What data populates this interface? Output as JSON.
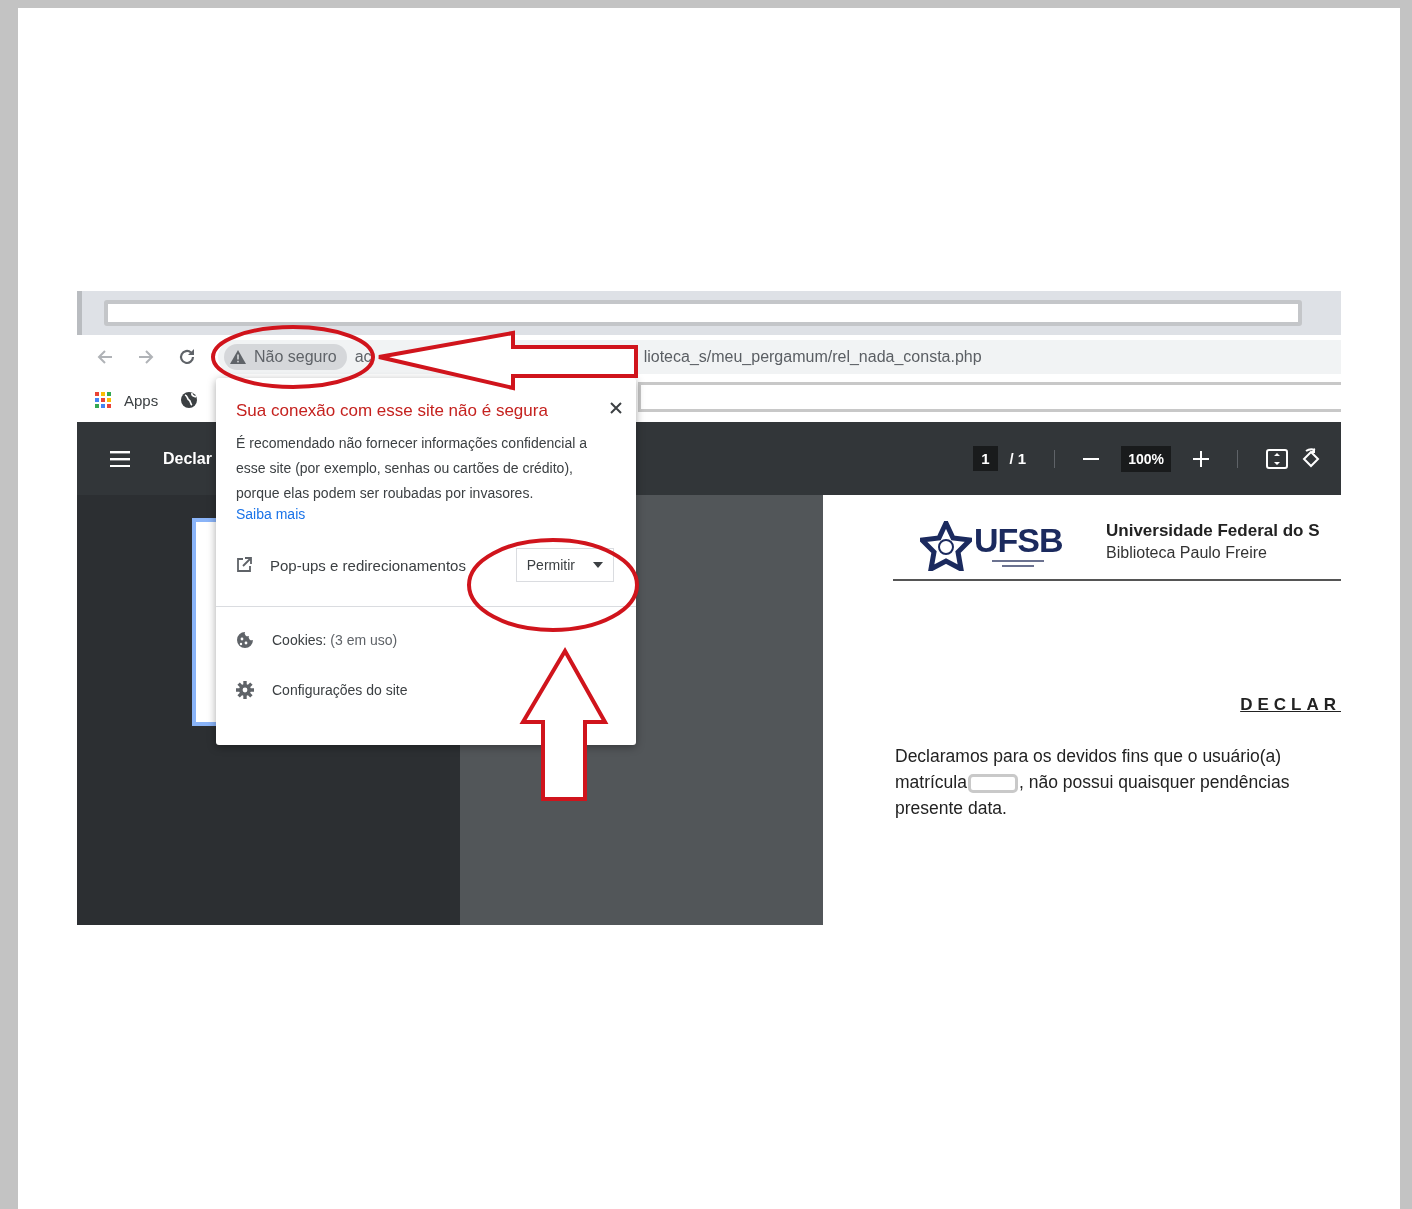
{
  "browser": {
    "omnibox": {
      "security_chip": "Não seguro",
      "url_start": "ac",
      "url_end": "lioteca_s/meu_pergamum/rel_nada_consta.php"
    },
    "bookmarks": [
      {
        "kind": "apps",
        "label": "Apps"
      },
      {
        "kind": "site"
      }
    ]
  },
  "pdf_toolbar": {
    "title": "Declar",
    "page": "1",
    "page_total": "/ 1",
    "zoom": "100%"
  },
  "site_popup": {
    "title": "Sua conexão com esse site não é segura",
    "body": "É recomendado não fornecer informações confidencial a esse site (por exemplo, senhas ou cartões de crédito), porque elas podem ser roubadas por invasores.",
    "link": "Saiba mais",
    "permissions": [
      {
        "label": "Pop-ups e redirecionamentos",
        "value": "Permitir"
      }
    ],
    "items": [
      {
        "kind": "cookies",
        "label": "Cookies:",
        "detail": "(3 em uso)"
      },
      {
        "kind": "settings",
        "label": "Configurações do site"
      }
    ]
  },
  "document": {
    "logo_text": "UFSB",
    "institution": "Universidade Federal do S",
    "library": "Biblioteca Paulo Freire",
    "heading": "DECLAR",
    "paragraph": {
      "line_1": "Declaramos para os devidos fins que o usuário(a)",
      "line_2_before": "matrícula",
      "redacted": true,
      "line_2_after": ", não possui quaisquer pendências",
      "line_3": "presente data."
    }
  }
}
